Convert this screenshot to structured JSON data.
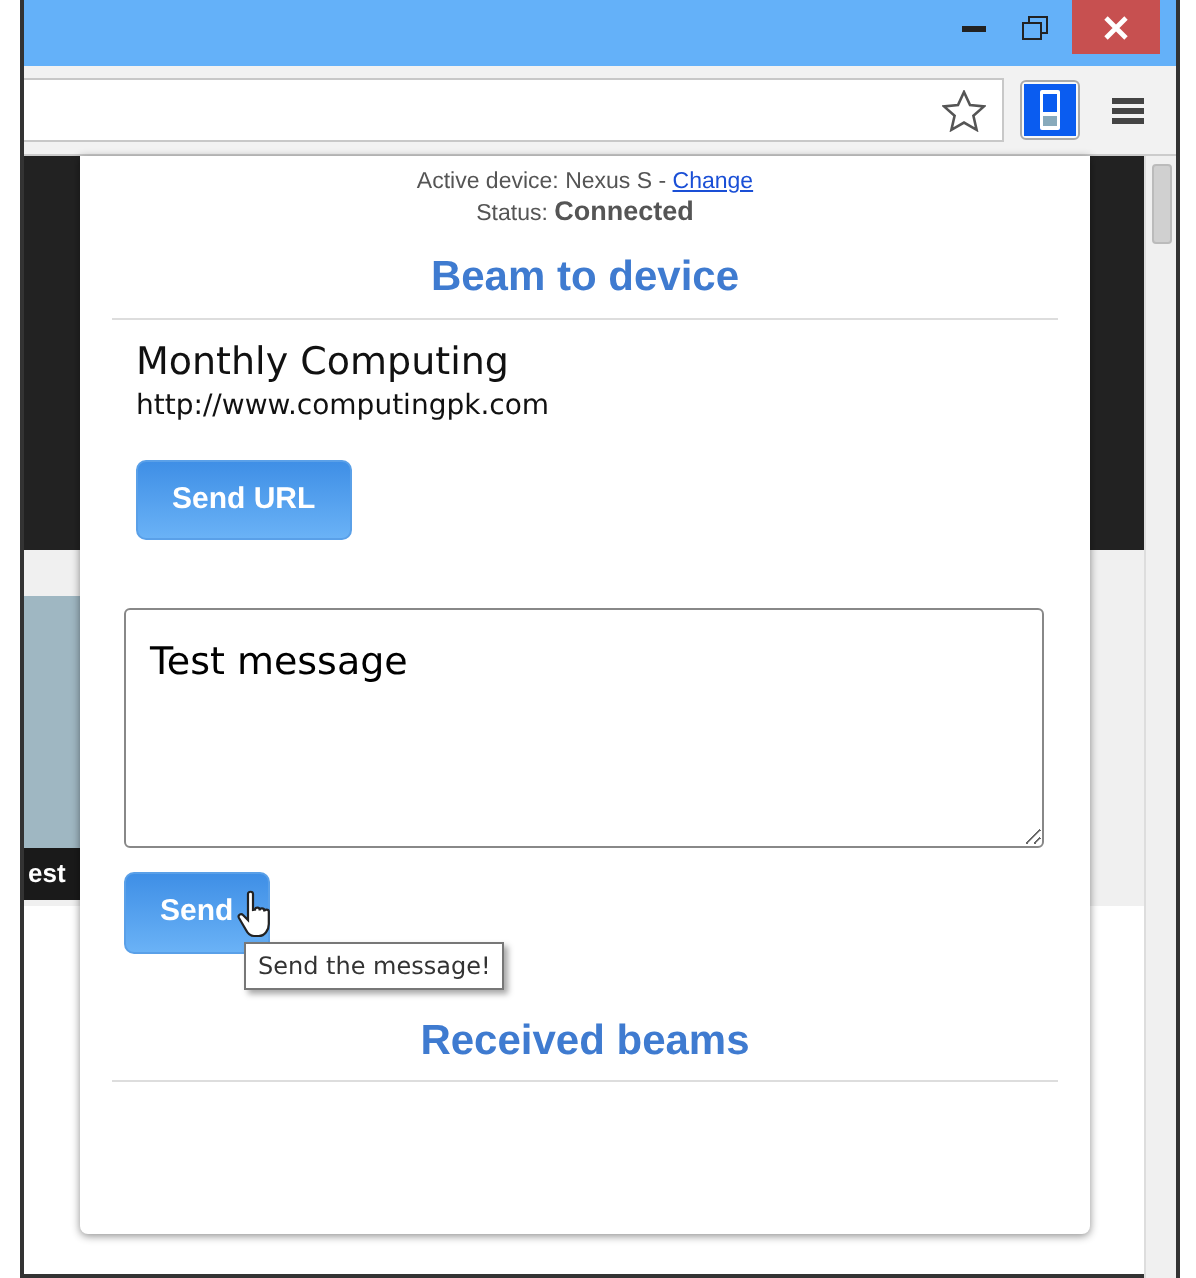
{
  "background_page": {
    "caption": "est"
  },
  "popup": {
    "active_device_label": "Active device: Nexus S -",
    "change_link": "Change",
    "status_label": "Status:",
    "status_value": "Connected",
    "beam_heading": "Beam to device",
    "page_title": "Monthly Computing",
    "page_url": "http://www.computingpk.com",
    "send_url_button": "Send URL",
    "message": "Test message",
    "send_button": "Send",
    "tooltip": "Send the message!",
    "received_heading": "Received beams"
  }
}
